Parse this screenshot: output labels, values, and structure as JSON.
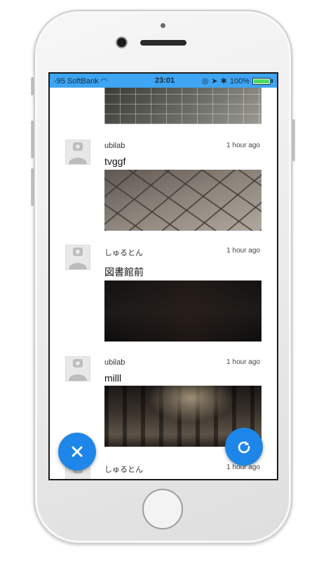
{
  "status_bar": {
    "carrier": "-95 SoftBank",
    "time": "23:01",
    "battery_percent": "100%",
    "battery_level": 1.0
  },
  "feed": {
    "posts": [
      {
        "user": "",
        "time": "",
        "text": "",
        "image": "ceiling-photo"
      },
      {
        "user": "ubilab",
        "time": "1 hour ago",
        "text": "tvggf",
        "image": "tile-floor-photo"
      },
      {
        "user": "しゅるとん",
        "time": "1 hour ago",
        "text": "図書館前",
        "image": "dark-night-photo"
      },
      {
        "user": "ubilab",
        "time": "1 hour ago",
        "text": "milll",
        "image": "corridor-photo"
      },
      {
        "user": "しゅるとん",
        "time": "1 hour ago",
        "text": "",
        "image": ""
      }
    ]
  },
  "fabs": {
    "close_icon": "close-icon",
    "refresh_icon": "refresh-icon",
    "color": "#1e86e8"
  },
  "colors": {
    "status_bar": "#3da5f3",
    "accent": "#1e86e8"
  }
}
